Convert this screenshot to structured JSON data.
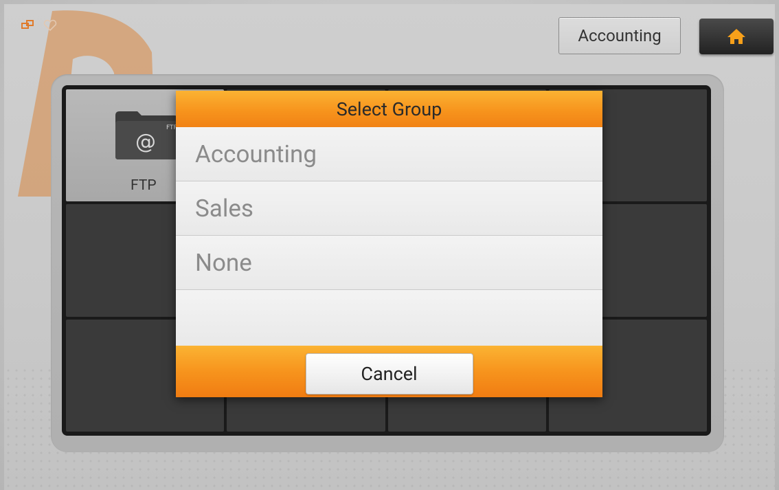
{
  "topbar": {
    "group_button_label": "Accounting"
  },
  "tiles": {
    "ftp_label": "FTP",
    "ftp_badge": "FTP"
  },
  "dialog": {
    "title": "Select Group",
    "options": [
      "Accounting",
      "Sales",
      "None"
    ],
    "cancel_label": "Cancel"
  },
  "colors": {
    "accent_orange": "#f7941d",
    "home_icon": "#f7a01a"
  }
}
